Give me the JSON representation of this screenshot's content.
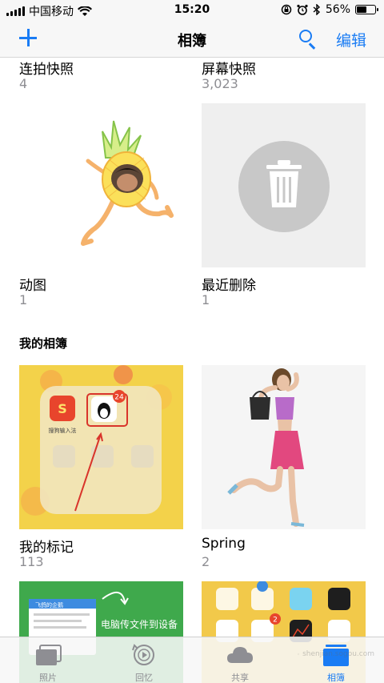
{
  "status": {
    "carrier": "中国移动",
    "time": "15:20",
    "battery_text": "56%",
    "battery_level": 0.56,
    "icons": [
      "signal-icon",
      "wifi-icon",
      "rotation-lock-icon",
      "alarm-icon",
      "bluetooth-icon",
      "battery-icon"
    ]
  },
  "nav": {
    "title": "相簿",
    "edit_label": "编辑",
    "add_icon": "plus-icon",
    "search_icon": "search-icon"
  },
  "albums_top": [
    {
      "label": "连拍快照",
      "count": "4"
    },
    {
      "label": "屏幕快照",
      "count": "3,023"
    }
  ],
  "albums_row2": [
    {
      "label": "动图",
      "count": "1"
    },
    {
      "label": "最近删除",
      "count": "1"
    }
  ],
  "section": {
    "my_albums": "我的相簿"
  },
  "albums_row3": [
    {
      "label": "我的标记",
      "count": "113"
    },
    {
      "label": "Spring",
      "count": "2"
    }
  ],
  "thumb_texts": {
    "qq_badge": "24",
    "app_caption": "搜狗输入法",
    "transfer_title": "飞鸽的企鹅",
    "transfer_caption": "电脑传文件到设备",
    "notes_badge": "2"
  },
  "tabs": [
    {
      "label": "照片",
      "icon": "photos-icon",
      "active": false
    },
    {
      "label": "回忆",
      "icon": "memories-icon",
      "active": false
    },
    {
      "label": "共享",
      "icon": "cloud-icon",
      "active": false
    },
    {
      "label": "相簿",
      "icon": "albums-icon",
      "active": true
    }
  ],
  "watermark": "shenjian.sogou.com",
  "colors": {
    "accent": "#1a7cf4",
    "secondary_text": "#8e8e93"
  }
}
